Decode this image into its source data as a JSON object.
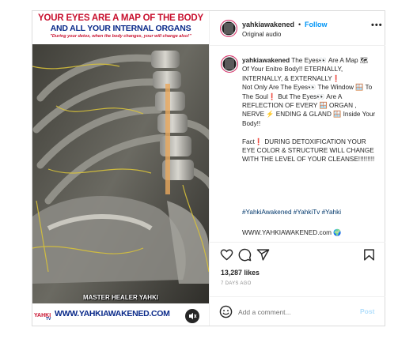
{
  "media": {
    "banner_line1": "YOUR EYES ARE A MAP OF THE BODY",
    "banner_line2": "AND ALL YOUR INTERNAL ORGANS",
    "banner_line3": "\"During your detox, when the body changes, your will change also!\"",
    "healer_label": "MASTER HEALER YAHKI",
    "logo_text": "YAHKI",
    "footer_url": "WWW.YAHKIAWAKENED.COM",
    "sound_icon": "speaker-muted-icon"
  },
  "header": {
    "username": "yahkiawakened",
    "separator": "•",
    "follow_label": "Follow",
    "audio_label": "Original audio",
    "more_icon": "more-horizontal-icon"
  },
  "caption": {
    "username": "yahkiawakened",
    "body": "The Eyes👀 Are A Map 🗺 Of Your Enitre Body!! ETERNALLY, INTERNALLY, & EXTERNALLY❗\nNot Only Are The Eyes👀 The Window 🪟 To The Soul❗ But The Eyes👀 Are A REFLECTION OF EVERY 🪟 ORGAN , NERVE ⚡ ENDING & GLAND 🪟 Inside Your Body!!\n\nFact❗ DURING DETOXIFICATION YOUR EYE COLOR & STRUCTURE WILL CHANGE WITH THE LEVEL OF YOUR CLEANSE!!!!!!!!!",
    "hashtags": "#YahkiAwakened #YahkiTv #Yahki",
    "website": "WWW.YAHKIAWAKENED.com 🌍"
  },
  "actions": {
    "like_icon": "heart-icon",
    "comment_icon": "comment-icon",
    "share_icon": "share-icon",
    "save_icon": "bookmark-icon",
    "likes": "13,287 likes",
    "posted_ago": "7 DAYS AGO"
  },
  "comment": {
    "emoji_icon": "smiley-icon",
    "placeholder": "Add a comment...",
    "post_label": "Post"
  },
  "colors": {
    "accent": "#0095f6",
    "text": "#262626",
    "muted": "#737373",
    "banner_red": "#c8102e",
    "banner_blue": "#0a2a8a"
  }
}
